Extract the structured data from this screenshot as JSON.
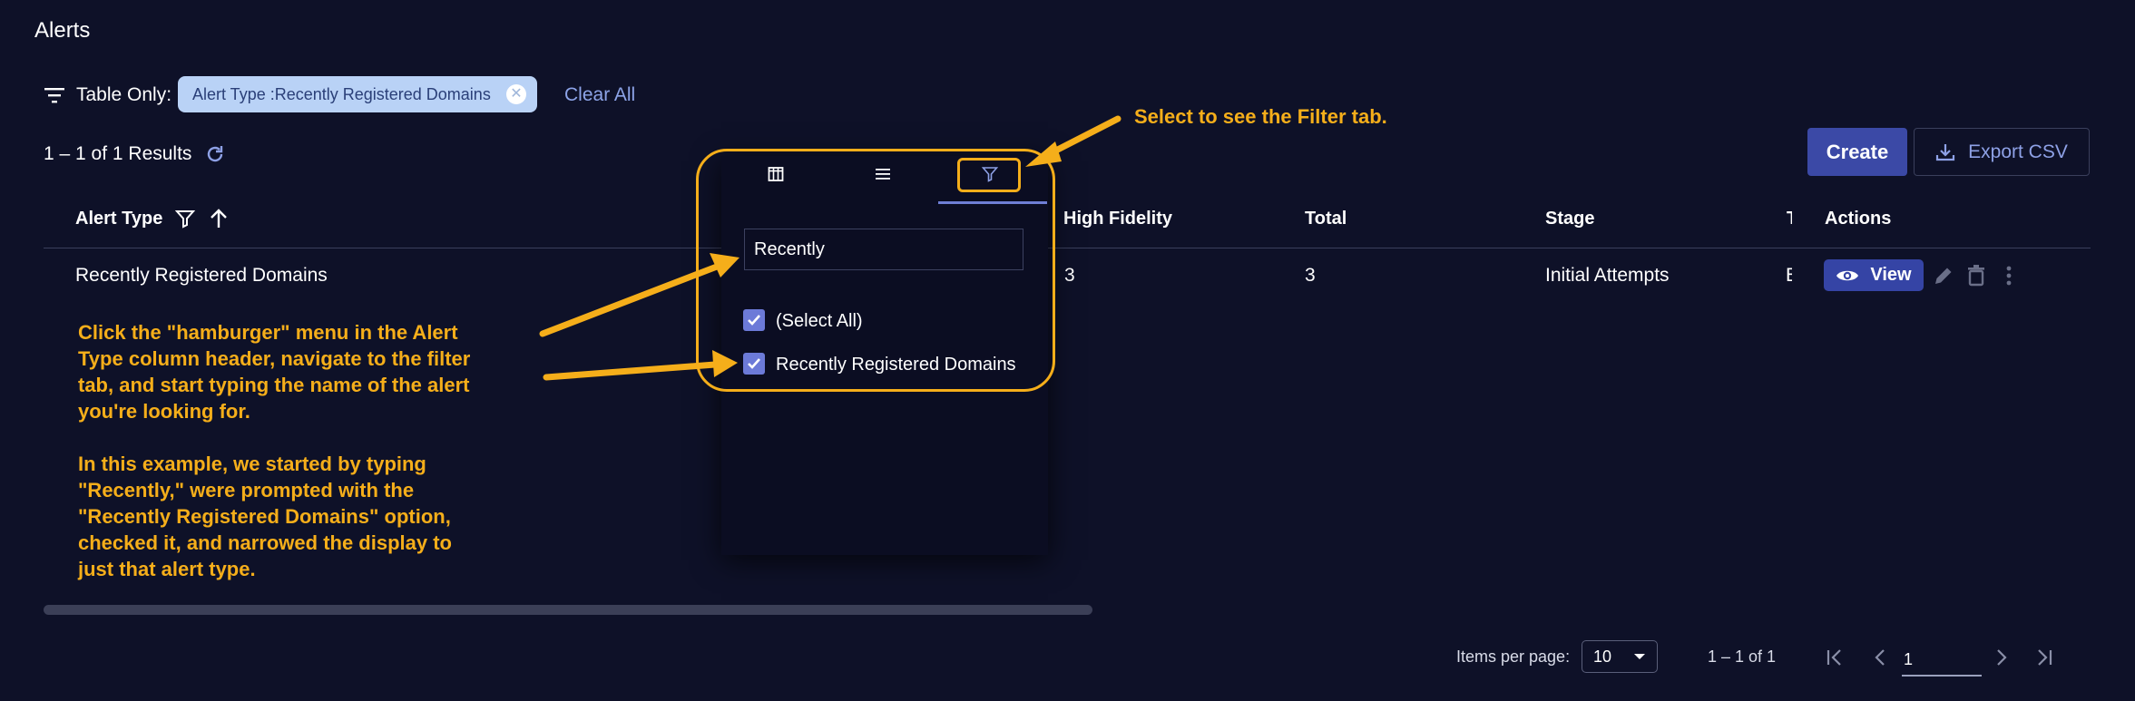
{
  "page_title": "Alerts",
  "filter_bar": {
    "table_only_label": "Table Only:",
    "chip_label": "Alert Type :Recently Registered Domains",
    "clear_all_label": "Clear All"
  },
  "results_label": "1 – 1 of 1 Results",
  "toolbar": {
    "create_label": "Create",
    "export_label": "Export CSV"
  },
  "table": {
    "columns": [
      "Alert Type",
      "High Fidelity",
      "Total",
      "Stage",
      "T",
      "Actions"
    ],
    "rows": [
      {
        "alert_type": "Recently Registered Domains",
        "high_fidelity": "3",
        "total": "3",
        "stage": "Initial Attempts",
        "t": "E"
      }
    ],
    "view_label": "View"
  },
  "filter_panel": {
    "search_value": "Recently",
    "options": [
      {
        "label": "(Select All)",
        "checked": true
      },
      {
        "label": "Recently Registered Domains",
        "checked": true
      }
    ]
  },
  "annotations": {
    "tab_hint": "Select to see the Filter tab.",
    "instructions": [
      "Click the \"hamburger\" menu in the Alert",
      "Type column header, navigate to the filter",
      "tab, and start typing the name of the alert",
      "you're looking for."
    ],
    "example": [
      "In this example, we started by typing",
      "\"Recently,\" were prompted with the",
      "\"Recently Registered Domains\" option,",
      "checked it, and narrowed the display to",
      "just that alert type."
    ]
  },
  "paginator": {
    "items_per_page_label": "Items per page:",
    "items_per_page_value": "10",
    "range_label": "1 – 1 of 1",
    "page_value": "1"
  },
  "colors": {
    "background": "#0e1128",
    "accent": "#3b49a6",
    "annotation": "#f5ae1a",
    "chip": "#b9d2f6"
  }
}
